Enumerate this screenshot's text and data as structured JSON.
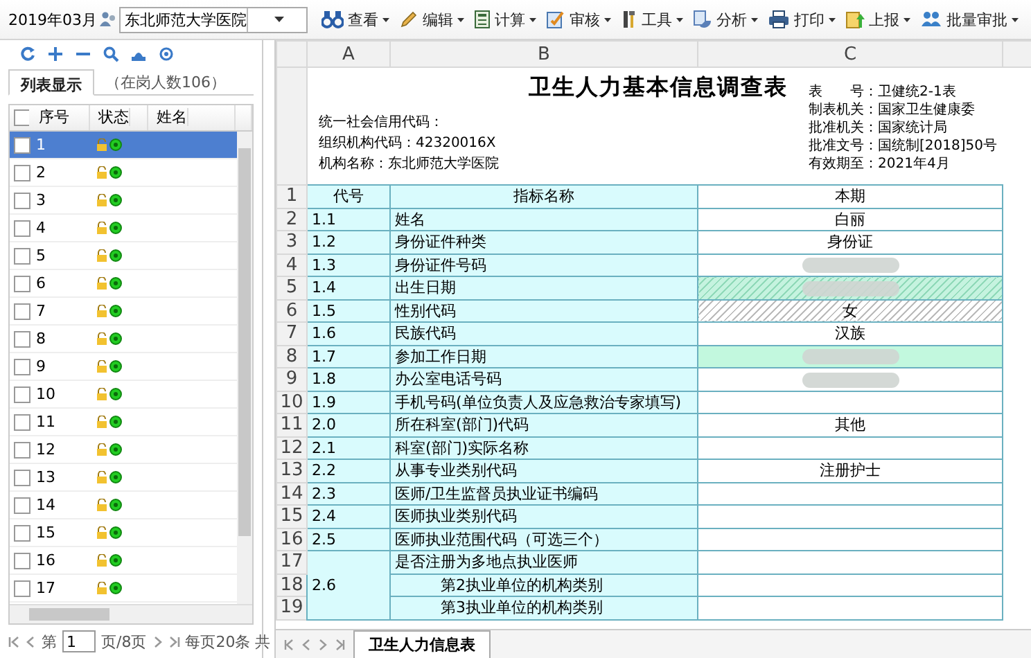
{
  "toolbar": {
    "period": "2019年03月",
    "org_select": "东北师范大学医院",
    "menus": [
      {
        "label": "查看"
      },
      {
        "label": "编辑"
      },
      {
        "label": "计算"
      },
      {
        "label": "审核"
      },
      {
        "label": "工具"
      },
      {
        "label": "分析"
      },
      {
        "label": "打印"
      },
      {
        "label": "上报"
      },
      {
        "label": "批量审批"
      }
    ]
  },
  "left_panel": {
    "tabs": [
      {
        "label": "列表显示",
        "selected": true
      },
      {
        "label": "（在岗人数106）",
        "selected": false
      }
    ],
    "header_checkbox": {
      "checked": false
    },
    "columns": [
      "序号",
      "状态",
      "姓名"
    ],
    "rows": [
      {
        "index": "1",
        "checked": false,
        "selected": true
      },
      {
        "index": "2",
        "checked": false,
        "selected": false
      },
      {
        "index": "3",
        "checked": false,
        "selected": false
      },
      {
        "index": "4",
        "checked": false,
        "selected": false
      },
      {
        "index": "5",
        "checked": false,
        "selected": false
      },
      {
        "index": "6",
        "checked": false,
        "selected": false
      },
      {
        "index": "7",
        "checked": false,
        "selected": false
      },
      {
        "index": "8",
        "checked": false,
        "selected": false
      },
      {
        "index": "9",
        "checked": false,
        "selected": false
      },
      {
        "index": "10",
        "checked": false,
        "selected": false
      },
      {
        "index": "11",
        "checked": false,
        "selected": false
      },
      {
        "index": "12",
        "checked": false,
        "selected": false
      },
      {
        "index": "13",
        "checked": false,
        "selected": false
      },
      {
        "index": "14",
        "checked": false,
        "selected": false
      },
      {
        "index": "15",
        "checked": false,
        "selected": false
      },
      {
        "index": "16",
        "checked": false,
        "selected": false
      },
      {
        "index": "17",
        "checked": false,
        "selected": false
      }
    ],
    "pager": {
      "prefix": "第",
      "page": "1",
      "suffix": "页/8页",
      "per_page": "每页20条 共"
    }
  },
  "sheet": {
    "column_headers": [
      "A",
      "B",
      "C"
    ],
    "title": "卫生人力基本信息调查表",
    "left_info": [
      "统一社会信用代码：",
      "组织机构代码：42320016X",
      "机构名称：东北师范大学医院"
    ],
    "right_info": [
      "表　　号：卫健统2-1表",
      "制表机关：国家卫生健康委",
      "批准机关：国家统计局",
      "批准文号：国统制[2018]50号",
      "有效期至：2021年4月"
    ],
    "header": {
      "row": "1",
      "code": "代号",
      "name": "指标名称",
      "value": "本期"
    },
    "rows": [
      {
        "row": "2",
        "code": "1.1",
        "name": "姓名",
        "value": "白丽",
        "hatched": false,
        "highlighted": false
      },
      {
        "row": "3",
        "code": "1.2",
        "name": "身份证件种类",
        "value": "身份证",
        "hatched": false,
        "highlighted": false
      },
      {
        "row": "4",
        "code": "1.3",
        "name": "身份证件号码",
        "redacted": true,
        "hatched": false,
        "highlighted": false
      },
      {
        "row": "5",
        "code": "1.4",
        "name": "出生日期",
        "redacted": true,
        "hatched": true,
        "highlighted": true
      },
      {
        "row": "6",
        "code": "1.5",
        "name": "性别代码",
        "value": "女",
        "hatched": true,
        "highlighted": false
      },
      {
        "row": "7",
        "code": "1.6",
        "name": "民族代码",
        "value": "汉族",
        "hatched": false,
        "highlighted": false
      },
      {
        "row": "8",
        "code": "1.7",
        "name": "参加工作日期",
        "redacted": true,
        "hatched": false,
        "highlighted": true
      },
      {
        "row": "9",
        "code": "1.8",
        "name": "办公室电话号码",
        "redacted": true,
        "hatched": false,
        "highlighted": false
      },
      {
        "row": "10",
        "code": "1.9",
        "name": "手机号码(单位负责人及应急救治专家填写)",
        "hatched": false,
        "highlighted": false
      },
      {
        "row": "11",
        "code": "2.0",
        "name": "所在科室(部门)代码",
        "value": "其他",
        "hatched": false,
        "highlighted": false
      },
      {
        "row": "12",
        "code": "2.1",
        "name": "科室(部门)实际名称",
        "hatched": false,
        "highlighted": false
      },
      {
        "row": "13",
        "code": "2.2",
        "name": "从事专业类别代码",
        "value": "注册护士",
        "hatched": false,
        "highlighted": false
      },
      {
        "row": "14",
        "code": "2.3",
        "name": "医师/卫生监督员执业证书编码",
        "hatched": false,
        "highlighted": false
      },
      {
        "row": "15",
        "code": "2.4",
        "name": "医师执业类别代码",
        "hatched": false,
        "highlighted": false
      },
      {
        "row": "16",
        "code": "2.5",
        "name": "医师执业范围代码（可选三个）",
        "hatched": false,
        "highlighted": false
      },
      {
        "row": "17",
        "code": "2.6",
        "name": "是否注册为多地点执业医师",
        "hatched": false,
        "highlighted": false
      },
      {
        "row": "18",
        "name": "第2执业单位的机构类别",
        "indented": true,
        "hatched": false,
        "highlighted": false
      },
      {
        "row": "19",
        "name": "第3执业单位的机构类别",
        "indented": true,
        "hatched": false,
        "highlighted": false
      }
    ],
    "sheet_tabs": [
      {
        "label": "卫生人力信息表",
        "selected": true
      }
    ]
  }
}
